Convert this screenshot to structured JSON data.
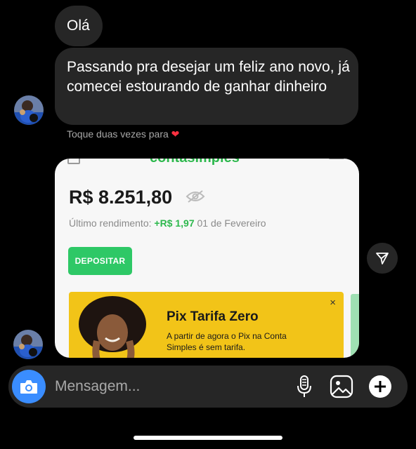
{
  "messages": [
    {
      "text": "Olá"
    },
    {
      "text": "Passando pra desejar um feliz ano novo, já comecei estourando de ganhar dinheiro"
    }
  ],
  "reaction_hint": "Toque duas vezes para",
  "shared_image": {
    "brand": "contasimples",
    "balance": "R$ 8.251,80",
    "last_yield_label": "Último rendimento:",
    "last_yield_value": "+R$ 1,97",
    "last_yield_date": "01 de Fevereiro",
    "deposit_label": "DEPOSITAR",
    "promo_title": "Pix Tarifa Zero",
    "promo_desc": "A partir de agora o Pix na Conta Simples é sem tarifa.",
    "promo_close": "×"
  },
  "composer": {
    "placeholder": "Mensagem..."
  },
  "colors": {
    "background": "#000000",
    "bubble": "#262626",
    "accent_green": "#2ec866",
    "camera_blue": "#3a8dff",
    "promo_yellow": "#f2c418",
    "heart": "#ff3040"
  }
}
